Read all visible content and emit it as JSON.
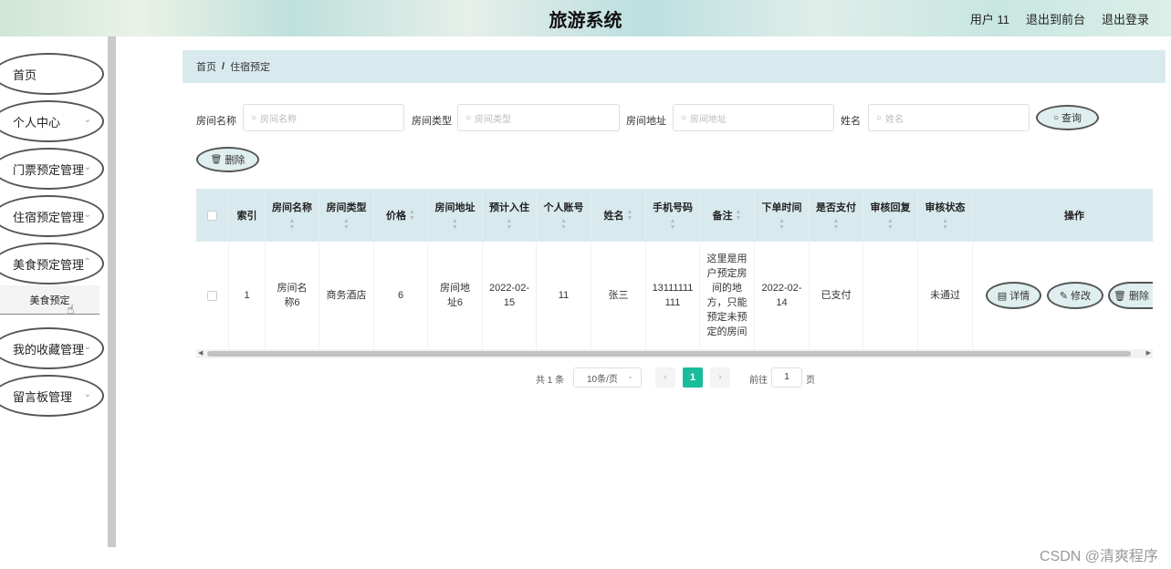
{
  "header": {
    "title": "旅游系统",
    "user": "用户 11",
    "to_front": "退出到前台",
    "logout": "退出登录"
  },
  "sidebar": {
    "items": [
      {
        "label": "首页",
        "icon": ""
      },
      {
        "label": "个人中心",
        "icon": "chevron-down-icon"
      },
      {
        "label": "门票预定管理",
        "icon": "chevron-down-icon"
      },
      {
        "label": "住宿预定管理",
        "icon": "chevron-down-icon"
      },
      {
        "label": "美食预定管理",
        "icon": "chevron-down-icon"
      },
      {
        "label": "我的收藏管理",
        "icon": "chevron-down-icon"
      },
      {
        "label": "留言板管理",
        "icon": "chevron-down-icon"
      }
    ],
    "sub_item": "美食预定"
  },
  "breadcrumb": {
    "home": "首页",
    "sep": "/",
    "current": "住宿预定"
  },
  "search": {
    "room_name_label": "房间名称",
    "room_name_placeholder": "房间名称",
    "room_type_label": "房间类型",
    "room_type_placeholder": "房间类型",
    "room_addr_label": "房间地址",
    "room_addr_placeholder": "房间地址",
    "name_label": "姓名",
    "name_placeholder": "姓名",
    "query_btn": "查询",
    "delete_btn": "删除"
  },
  "table": {
    "headers": [
      "索引",
      "房间名称",
      "房间类型",
      "价格",
      "房间地址",
      "预计入住",
      "个人账号",
      "姓名",
      "手机号码",
      "备注",
      "下单时间",
      "是否支付",
      "审核回复",
      "审核状态",
      "操作"
    ],
    "row": {
      "index": "1",
      "room_name": "房间名称6",
      "room_type": "商务酒店",
      "price": "6",
      "room_addr": "房间地址6",
      "checkin": "2022-02-15",
      "account": "11",
      "name": "张三",
      "phone": "13111111111",
      "remark": "这里是用户预定房间的地方，只能预定未预定的房间",
      "order_time": "2022-02-14",
      "paid": "已支付",
      "reply": "",
      "status": "未通过"
    },
    "ops": {
      "detail": "详情",
      "edit": "修改",
      "delete": "删除"
    }
  },
  "pagination": {
    "total": "共 1 条",
    "page_size": "10条/页",
    "current": "1",
    "goto_label": "前往",
    "goto_value": "1",
    "page_unit": "页"
  },
  "watermark": "CSDN @清爽程序",
  "colors": {
    "accent": "#1abc9c",
    "header_bg": "#d9eaee"
  }
}
